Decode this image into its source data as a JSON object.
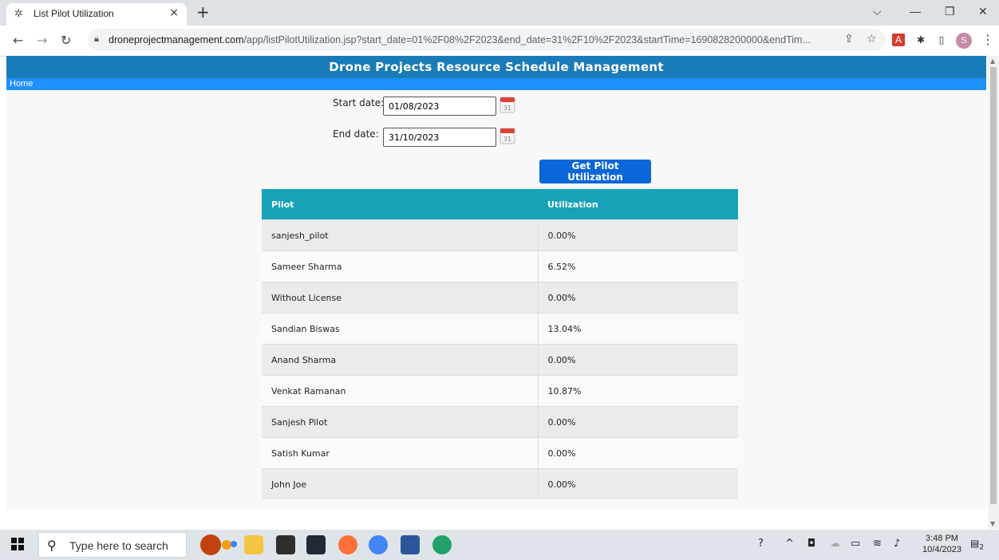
{
  "browser": {
    "tab_title": "List Pilot Utilization",
    "tab_close": "×",
    "new_tab": "+",
    "url_host": "droneprojectmanagement.com",
    "url_path": "/app/listPilotUtilization.jsp?start_date=01%2F08%2F2023&end_date=31%2F10%2F2023&startTime=1690828200000&endTim...",
    "profile_initial": "S",
    "window_controls": {
      "dropdown": "⌵",
      "minimize": "—",
      "restore": "❐",
      "close": "✕"
    }
  },
  "app": {
    "header_title": "Drone Projects Resource Schedule Management",
    "nav_home": "Home"
  },
  "form": {
    "start_label": "Start date:",
    "start_value": "01/08/2023",
    "end_label": "End date:",
    "end_value": "31/10/2023",
    "calendar_day": "31",
    "submit_label": "Get Pilot Utilization"
  },
  "table": {
    "headers": [
      "Pilot",
      "Utilization"
    ],
    "rows": [
      {
        "pilot": "sanjesh_pilot",
        "utilization": "0.00%"
      },
      {
        "pilot": "Sameer Sharma",
        "utilization": "6.52%"
      },
      {
        "pilot": "Without License",
        "utilization": "0.00%"
      },
      {
        "pilot": "Sandian Biswas",
        "utilization": "13.04%"
      },
      {
        "pilot": "Anand Sharma",
        "utilization": "0.00%"
      },
      {
        "pilot": "Venkat Ramanan",
        "utilization": "10.87%"
      },
      {
        "pilot": "Sanjesh Pilot",
        "utilization": "0.00%"
      },
      {
        "pilot": "Satish Kumar",
        "utilization": "0.00%"
      },
      {
        "pilot": "John Joe",
        "utilization": "0.00%"
      }
    ]
  },
  "taskbar": {
    "search_placeholder": "Type here to search",
    "time": "3:48 PM",
    "date": "10/4/2023",
    "notification_count": "2"
  },
  "colors": {
    "header_bg": "#1a7bb9",
    "nav_bg": "#1e90ff",
    "table_header_bg": "#17a2b8",
    "button_bg": "#0b66d9"
  }
}
